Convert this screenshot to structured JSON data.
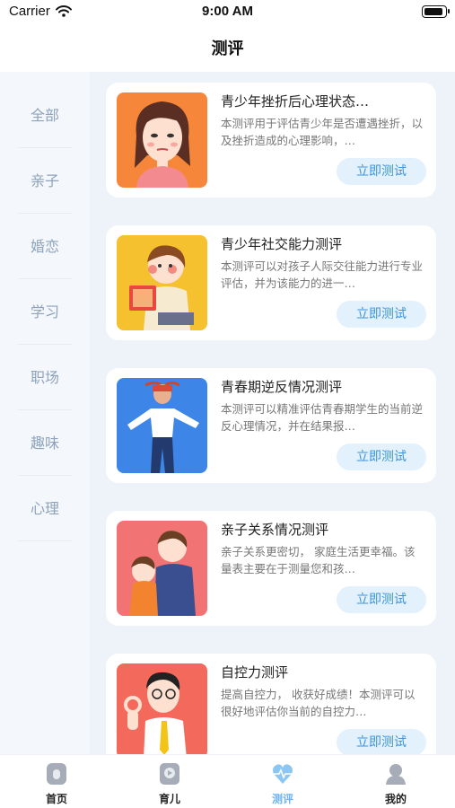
{
  "status_bar": {
    "carrier": "Carrier",
    "time": "9:00 AM"
  },
  "header": {
    "title": "测评"
  },
  "sidebar": {
    "items": [
      {
        "label": "全部"
      },
      {
        "label": "亲子"
      },
      {
        "label": "婚恋"
      },
      {
        "label": "学习"
      },
      {
        "label": "职场"
      },
      {
        "label": "趣味"
      },
      {
        "label": "心理"
      }
    ]
  },
  "cards": [
    {
      "title": "青少年挫折后心理状态…",
      "desc": "本测评用于评估青少年是否遭遇挫折，以及挫折造成的心理影响，…",
      "button": "立即测试",
      "thumb_color": "#f6873a",
      "thumb_icon": "girl-portrait-icon"
    },
    {
      "title": "青少年社交能力测评",
      "desc": "本测评可以对孩子人际交往能力进行专业评估，并为该能力的进一…",
      "button": "立即测试",
      "thumb_color": "#f5c12e",
      "thumb_icon": "boy-reading-icon"
    },
    {
      "title": "青春期逆反情况测评",
      "desc": "本测评可以精准评估青春期学生的当前逆反心理情况，并在结果报…",
      "button": "立即测试",
      "thumb_color": "#3d86e8",
      "thumb_icon": "angry-teen-icon"
    },
    {
      "title": "亲子关系情况测评",
      "desc": "亲子关系更密切， 家庭生活更幸福。该量表主要在于测量您和孩…",
      "button": "立即测试",
      "thumb_color": "#f27374",
      "thumb_icon": "parent-child-icon"
    },
    {
      "title": "自控力测评",
      "desc": "提高自控力， 收获好成绩！本测评可以很好地评估你当前的自控力…",
      "button": "立即测试",
      "thumb_color": "#f36a5c",
      "thumb_icon": "ok-gesture-man-icon"
    }
  ],
  "tab_bar": {
    "tabs": [
      {
        "label": "首页",
        "icon": "home-icon"
      },
      {
        "label": "育儿",
        "icon": "parenting-icon"
      },
      {
        "label": "测评",
        "icon": "assessment-icon"
      },
      {
        "label": "我的",
        "icon": "profile-icon"
      }
    ],
    "active_index": 2,
    "active_color": "#6fb4ef"
  }
}
